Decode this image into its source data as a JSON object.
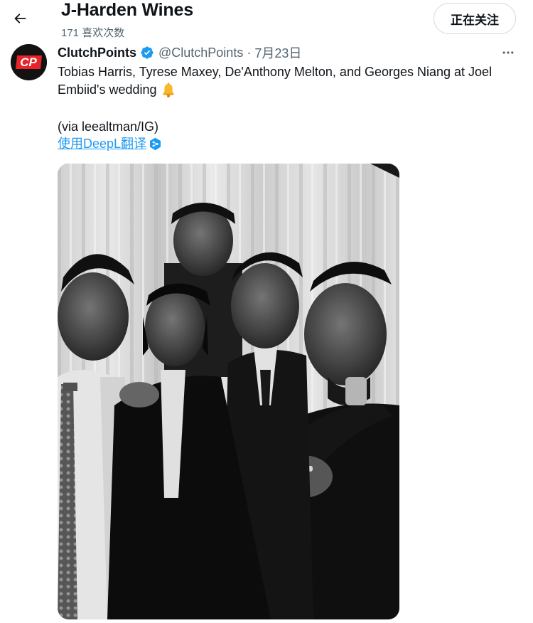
{
  "header": {
    "title": "J-Harden Wines",
    "likes_count": "171 喜欢次数",
    "follow_label": "正在关注",
    "back_icon": "arrow-left-icon"
  },
  "tweet": {
    "author_name": "ClutchPoints",
    "handle": "@ClutchPoints",
    "separator": "·",
    "date": "7月23日",
    "avatar_text": "CP",
    "text_line1": "Tobias Harris, Tyrese Maxey, De'Anthony Melton, and Georges Niang at Joel",
    "text_line2": "Embiid's wedding",
    "text_emoji": "bell-icon",
    "via": "(via leealtman/IG)",
    "translate_label": "使用DeepL翻译",
    "more_icon": "more-horizontal-icon",
    "verified_icon": "verified-badge-icon"
  },
  "colors": {
    "link": "#1d9bf0",
    "secondary_text": "#536471",
    "primary_text": "#0f1419",
    "verified": "#1d9bf0",
    "avatar_red": "#e8232a"
  }
}
